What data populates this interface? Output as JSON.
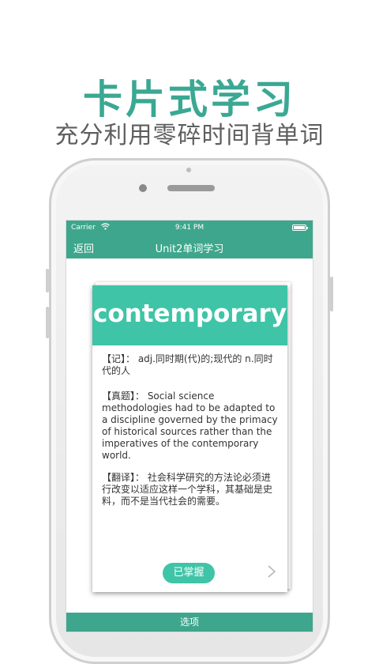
{
  "promo": {
    "headline": "卡片式学习",
    "subheadline": "充分利用零碎时间背单词"
  },
  "status_bar": {
    "carrier": "Carrier",
    "wifi_icon": "wifi-icon",
    "time": "9:41 PM",
    "battery_icon": "battery-icon"
  },
  "nav": {
    "back_label": "返回",
    "title": "Unit2单词学习"
  },
  "card": {
    "word": "contemporary",
    "memo": "【记】： adj.同时期(代)的;现代的 n.同时代的人",
    "exam": "【真题】： Social science methodologies had to be adapted to a discipline governed by the primacy of historical sources rather than the imperatives of the contemporary world.",
    "translation": "【翻译】： 社会科学研究的方法论必须进行改变以适应这样一个学科，其基础是史料，而不是当代社会的需要。",
    "mastered_label": "已掌握",
    "next_icon": "chevron-right-icon"
  },
  "tab_bar": {
    "options_label": "选项"
  },
  "colors": {
    "headline": "#3aa892",
    "nav_bar": "#3ea68c",
    "card_header": "#3fc4a7",
    "subheadline": "#5e5e5e"
  }
}
